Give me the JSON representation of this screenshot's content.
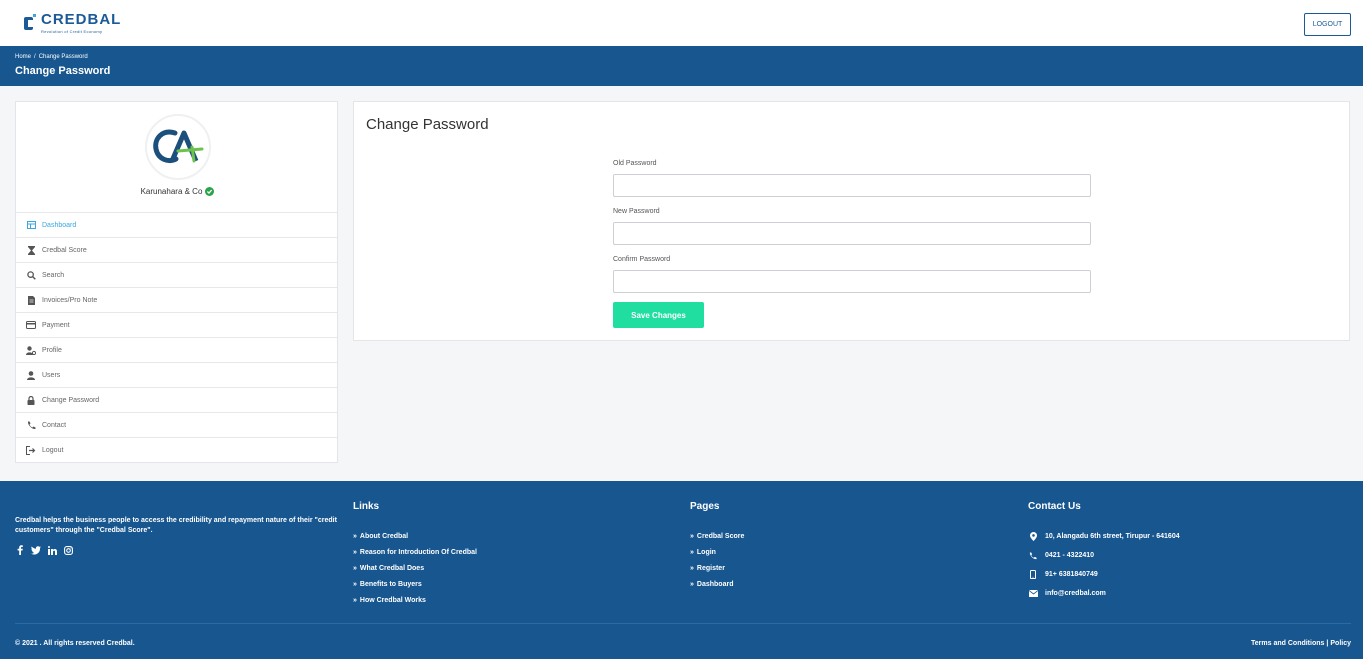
{
  "header": {
    "logo_name": "CREDBAL",
    "logo_tagline": "Revolution of Credit Economy",
    "logout_label": "LOGOUT"
  },
  "band": {
    "breadcrumb": [
      "Home",
      "/",
      "Change Password"
    ],
    "title": "Change Password"
  },
  "sidebar": {
    "company": "Karunahara & Co",
    "avatar_text": "CA",
    "items": [
      {
        "label": "Dashboard",
        "icon": "dashboard-icon",
        "active": true
      },
      {
        "label": "Credbal Score",
        "icon": "hourglass-icon",
        "active": false
      },
      {
        "label": "Search",
        "icon": "search-icon",
        "active": false
      },
      {
        "label": "Invoices/Pro Note",
        "icon": "document-icon",
        "active": false
      },
      {
        "label": "Payment",
        "icon": "credit-card-icon",
        "active": false
      },
      {
        "label": "Profile",
        "icon": "user-gear-icon",
        "active": false
      },
      {
        "label": "Users",
        "icon": "user-icon",
        "active": false
      },
      {
        "label": "Change Password",
        "icon": "lock-icon",
        "active": false
      },
      {
        "label": "Contact",
        "icon": "phone-icon",
        "active": false
      },
      {
        "label": "Logout",
        "icon": "sign-out-icon",
        "active": false
      }
    ]
  },
  "form": {
    "title": "Change Password",
    "old_label": "Old Password",
    "old_value": "",
    "new_label": "New Password",
    "new_value": "",
    "confirm_label": "Confirm Password",
    "confirm_value": "",
    "save_label": "Save Changes"
  },
  "footer": {
    "about": "Credbal helps the business people to access the credibility and repayment nature of their \"credit customers\" through the \"Credbal Score\".",
    "social_icons": [
      "facebook-icon",
      "twitter-icon",
      "linkedin-icon",
      "instagram-icon"
    ],
    "links_title": "Links",
    "links": [
      "About Credbal",
      "Reason for Introduction Of Credbal",
      "What Credbal Does",
      "Benefits to Buyers",
      "How Credbal Works"
    ],
    "pages_title": "Pages",
    "pages": [
      "Credbal Score",
      "Login",
      "Register",
      "Dashboard"
    ],
    "contact_title": "Contact Us",
    "contact": [
      {
        "icon": "map-pin-icon",
        "text": "10, Alangadu 6th street, Tirupur - 641604"
      },
      {
        "icon": "phone-icon",
        "text": "0421 - 4322410"
      },
      {
        "icon": "mobile-icon",
        "text": "91+ 6381840749"
      },
      {
        "icon": "envelope-icon",
        "text": "info@credbal.com"
      }
    ],
    "copyright": "© 2021 . All rights reserved Credbal.",
    "terms": "Terms and Conditions",
    "separator": "|",
    "policy": "Policy"
  },
  "colors": {
    "brand_blue": "#17568f",
    "accent_green": "#1fdea0",
    "active_link": "#3aa7e0"
  }
}
